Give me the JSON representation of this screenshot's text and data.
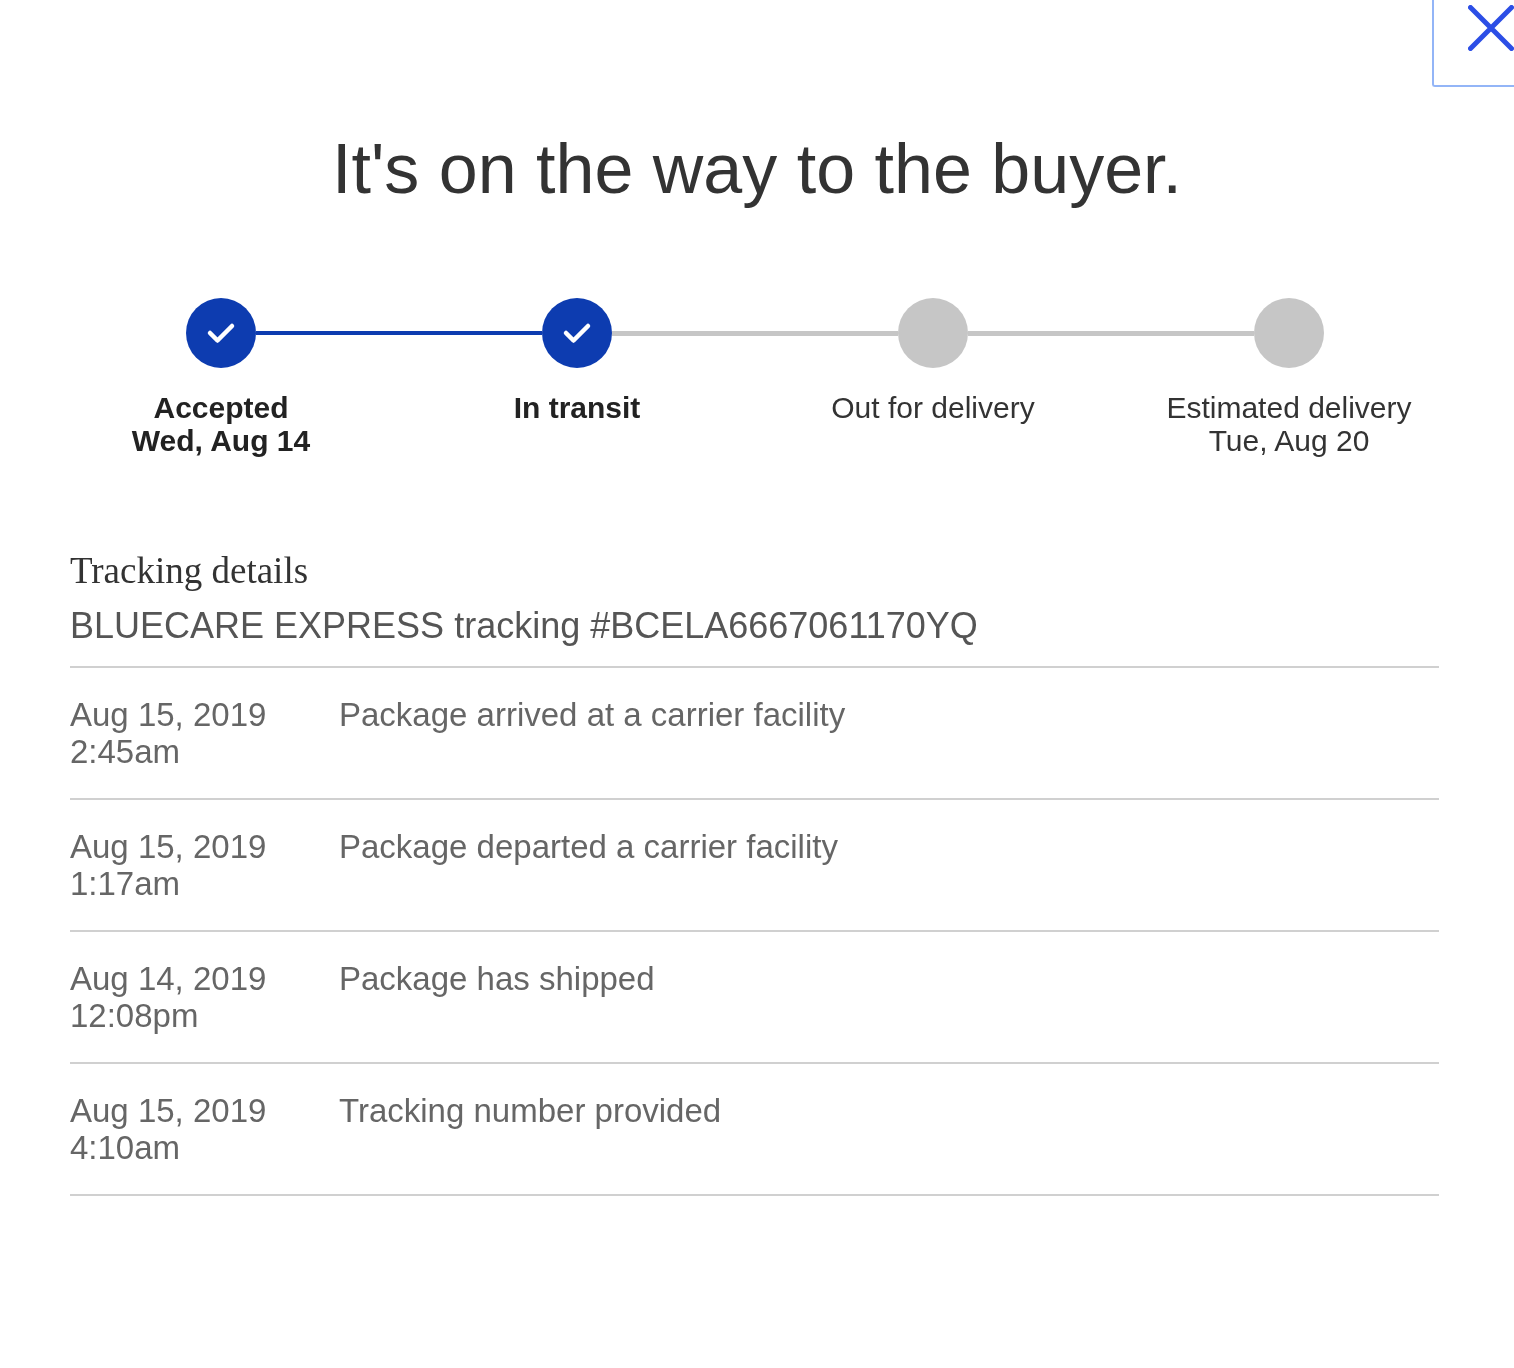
{
  "close_button": {
    "focused": true
  },
  "title": "It's on the way to the buyer.",
  "progress": [
    {
      "label": "Accepted",
      "date": "Wed, Aug 14",
      "completed": true
    },
    {
      "label": "In transit",
      "completed": true
    },
    {
      "label": "Out for delivery",
      "completed": false
    },
    {
      "label": "Estimated delivery",
      "date": "Tue, Aug 20",
      "completed": false
    }
  ],
  "tracking": {
    "heading": "Tracking details",
    "carrier_line": "BLUECARE EXPRESS tracking #BCELA6667061170YQ",
    "events": [
      {
        "date": "Aug 15, 2019",
        "time": "2:45am",
        "description": "Package arrived at a carrier facility"
      },
      {
        "date": "Aug 15, 2019",
        "time": "1:17am",
        "description": "Package departed a carrier facility"
      },
      {
        "date": "Aug 14, 2019",
        "time": "12:08pm",
        "description": "Package has shipped"
      },
      {
        "date": "Aug 15, 2019",
        "time": "4:10am",
        "description": "Tracking number provided"
      }
    ]
  }
}
